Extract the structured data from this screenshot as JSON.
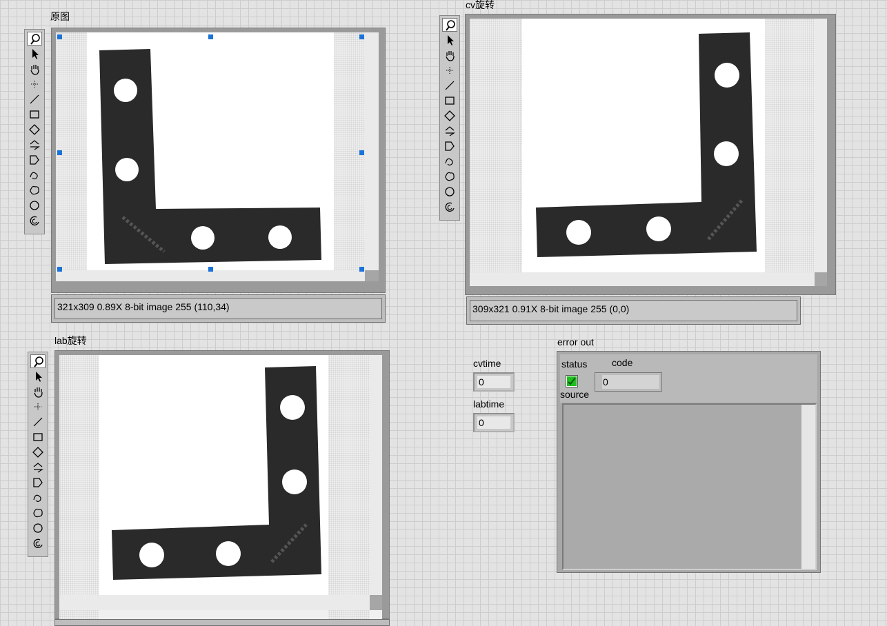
{
  "panels": {
    "original": {
      "label": "原图",
      "status": "321x309 0.89X 8-bit image 255    (110,34)"
    },
    "cv_rotate": {
      "label": "cv旋转",
      "status": "309x321 0.91X 8-bit image 255    (0,0)"
    },
    "lab_rotate": {
      "label": "lab旋转"
    }
  },
  "toolbox_icons": [
    "zoom-icon",
    "select-pointer-icon",
    "pan-hand-icon",
    "point-tool-icon",
    "line-tool-icon",
    "rectangle-tool-icon",
    "rotated-rect-tool-icon",
    "annulus-tool-icon",
    "polygon-tool-icon",
    "freehand-line-tool-icon",
    "freehand-region-tool-icon",
    "oval-tool-icon",
    "broken-annulus-tool-icon"
  ],
  "indicators": {
    "cvtime": {
      "label": "cvtime",
      "value": "0"
    },
    "labtime": {
      "label": "labtime",
      "value": "0"
    }
  },
  "error_out": {
    "title": "error out",
    "status_label": "status",
    "code_label": "code",
    "code_value": "0",
    "code_radix": "d",
    "source_label": "source",
    "status_ok": true
  },
  "colors": {
    "selection_handle": "#1a73d9",
    "status_ok_green": "#1fbf1f",
    "part_black": "#2a2a2a"
  }
}
